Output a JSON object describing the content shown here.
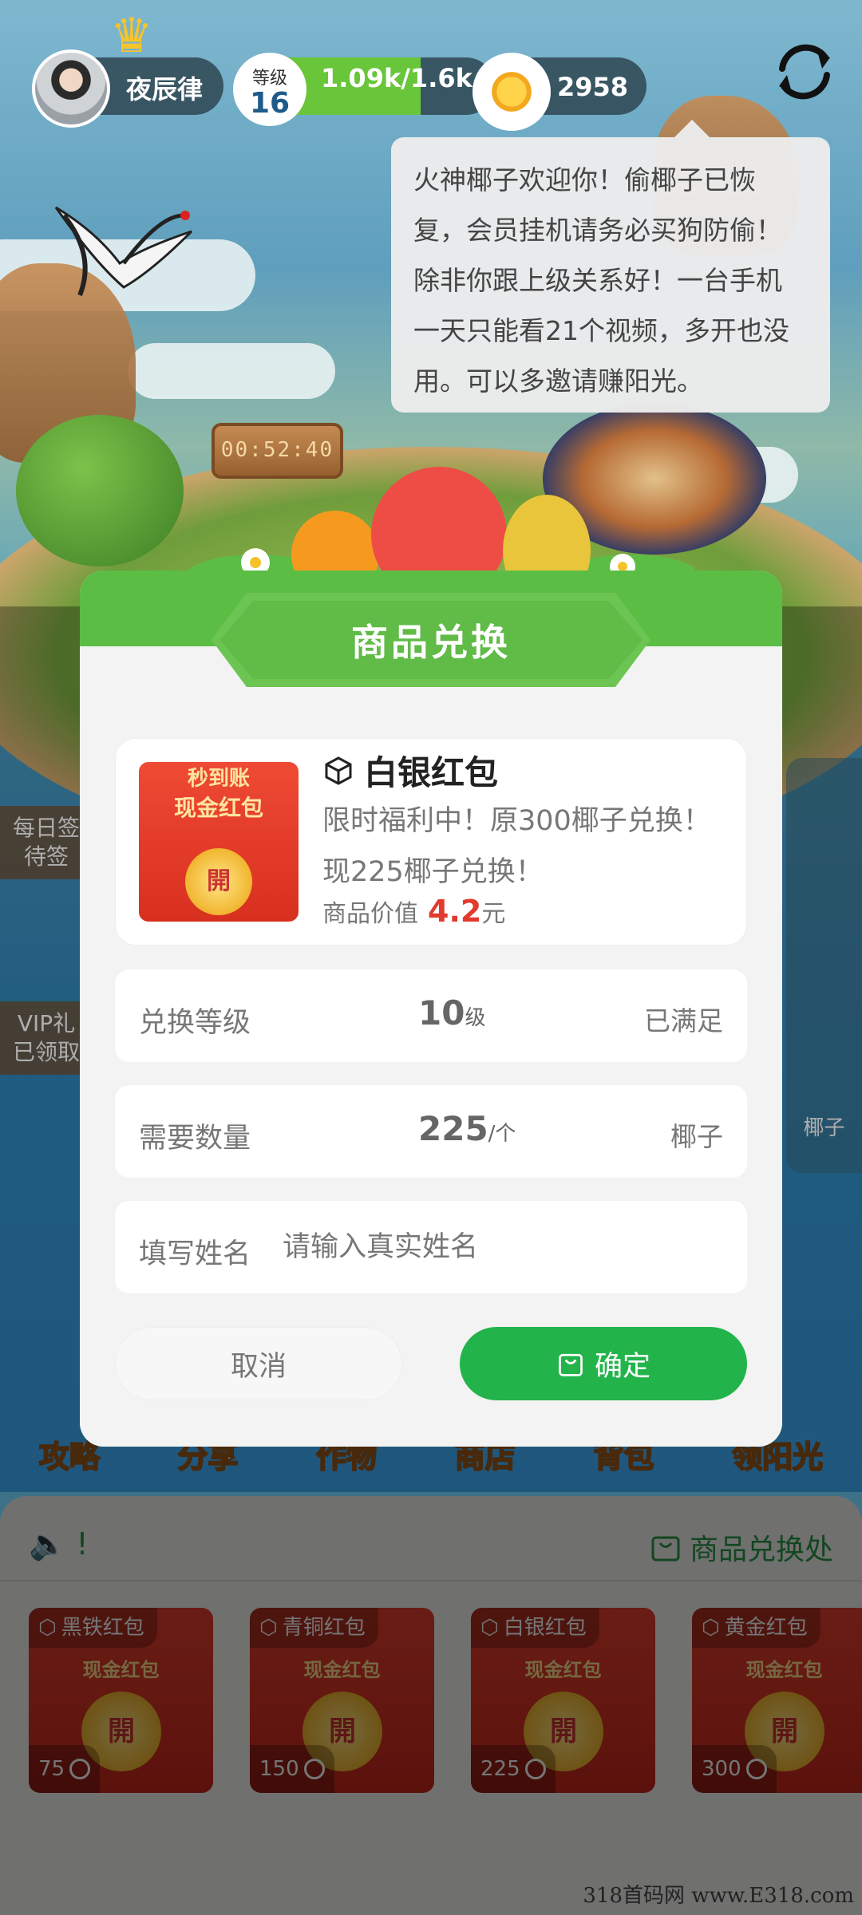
{
  "hud": {
    "user_name": "夜辰律",
    "level_label": "等级",
    "level_value": "16",
    "xp_text": "1.09k/1.6k",
    "xp_progress": 0.68,
    "sunshine_count": "2958"
  },
  "tooltip": {
    "message": "火神椰子欢迎你！偷椰子已恢复，会员挂机请务必买狗防偷！除非你跟上级关系好！一台手机一天只能看21个视频，多开也没用。可以多邀请赚阳光。"
  },
  "scene": {
    "timer": "00:52:40",
    "side_labels": [
      "每日签",
      "待签",
      "VIP礼",
      "已领取"
    ],
    "right_label": "椰子",
    "nav": [
      "攻略",
      "分享",
      "作物",
      "商店",
      "背包",
      "领阳光"
    ]
  },
  "dialog": {
    "title": "商品兑换",
    "product": {
      "thumb_line1": "秒到账",
      "thumb_line2": "现金红包",
      "thumb_coin": "開",
      "name": "白银红包",
      "description": "限时福利中！原300椰子兑换！现225椰子兑换！",
      "value_label": "商品价值",
      "value_amount": "4.2",
      "value_unit": "元"
    },
    "level_row": {
      "label": "兑换等级",
      "value": "10",
      "unit": "级",
      "status": "已满足"
    },
    "quantity_row": {
      "label": "需要数量",
      "value": "225",
      "unit": "/个",
      "currency": "椰子"
    },
    "name_row": {
      "label": "填写姓名",
      "placeholder": "请输入真实姓名",
      "value": ""
    },
    "cancel_label": "取消",
    "confirm_label": "确定"
  },
  "bottom_panel": {
    "announcement": "!",
    "shop_link_label": "商品兑换处",
    "cards": [
      {
        "name": "黑铁红包",
        "subtitle": "现金红包",
        "coin": "開",
        "price": "75"
      },
      {
        "name": "青铜红包",
        "subtitle": "现金红包",
        "coin": "開",
        "price": "150"
      },
      {
        "name": "白银红包",
        "subtitle": "现金红包",
        "coin": "開",
        "price": "225"
      },
      {
        "name": "黄金红包",
        "subtitle": "现金红包",
        "coin": "開",
        "price": "300"
      }
    ]
  },
  "watermark": "318首码网 www.E318.com",
  "colors": {
    "primary_green": "#22b44b",
    "header_green": "#5cbd45",
    "value_red": "#e23a2e",
    "xp_green": "#69c63a"
  }
}
